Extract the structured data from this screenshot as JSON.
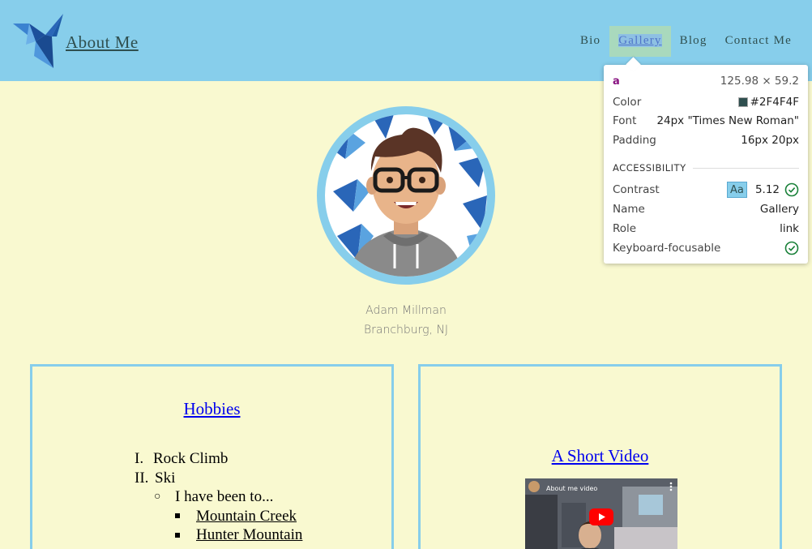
{
  "header": {
    "site_title": "About Me",
    "nav": [
      {
        "label": "Bio"
      },
      {
        "label": "Gallery",
        "active": true
      },
      {
        "label": "Blog"
      },
      {
        "label": "Contact Me"
      }
    ]
  },
  "inspector": {
    "tag": "a",
    "dimensions": "125.98 × 59.2",
    "color_label": "Color",
    "color_value": "#2F4F4F",
    "font_label": "Font",
    "font_value": "24px \"Times New Roman\"",
    "padding_label": "Padding",
    "padding_value": "16px 20px",
    "section_title": "ACCESSIBILITY",
    "contrast_label": "Contrast",
    "contrast_badge": "Aa",
    "contrast_value": "5.12",
    "name_label": "Name",
    "name_value": "Gallery",
    "role_label": "Role",
    "role_value": "link",
    "keyboard_label": "Keyboard-focusable"
  },
  "profile": {
    "name": "Adam Millman",
    "location": "Branchburg, NJ"
  },
  "hobbies": {
    "heading": "Hobbies",
    "items": [
      {
        "num": "I.",
        "text": "Rock Climb"
      },
      {
        "num": "II.",
        "text": "Ski"
      }
    ],
    "sub_text": "I have been to...",
    "places": [
      "Mountain Creek",
      "Hunter Mountain"
    ]
  },
  "video": {
    "heading": "A Short Video",
    "title": "About me video"
  },
  "colors": {
    "header_bg": "#87CEEB",
    "page_bg": "#F9F9D0",
    "nav_text": "#2F4F4F",
    "link": "#0000EE"
  }
}
